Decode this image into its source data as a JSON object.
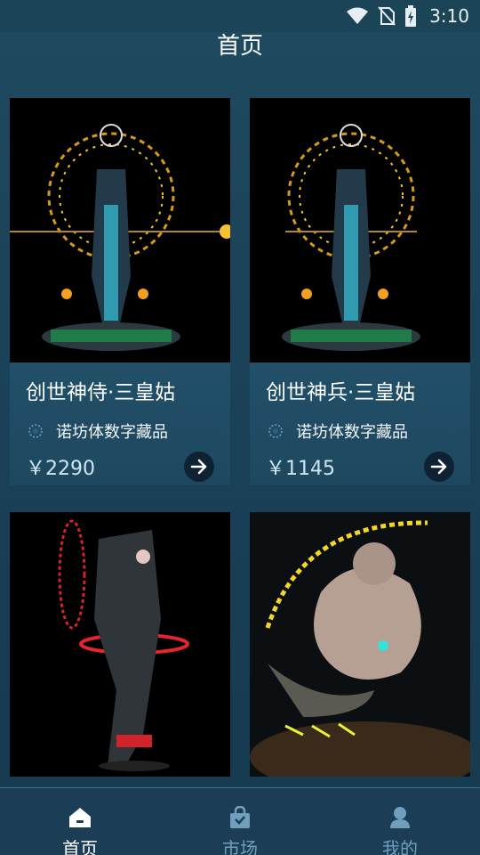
{
  "status_bar": {
    "time": "3:10",
    "icons": [
      "wifi-icon",
      "no-sim-icon",
      "battery-charging-icon"
    ]
  },
  "header": {
    "title": "首页"
  },
  "cards": [
    {
      "title": "创世神侍·三皇姑",
      "brand": "诺坊体数字藏品",
      "price": "￥2290",
      "image": "deity-statue-gold-halo"
    },
    {
      "title": "创世神兵·三皇姑",
      "brand": "诺坊体数字藏品",
      "price": "￥1145",
      "image": "deity-statue-gold-halo"
    },
    {
      "title": "",
      "brand": "",
      "price": "",
      "image": "mech-warrior-red-rings"
    },
    {
      "title": "",
      "brand": "",
      "price": "",
      "image": "ogre-golden-script-arc"
    }
  ],
  "tabs": [
    {
      "label": "首页",
      "icon": "home-icon",
      "active": true
    },
    {
      "label": "市场",
      "icon": "shopping-bag-icon",
      "active": false
    },
    {
      "label": "我的",
      "icon": "user-icon",
      "active": false
    }
  ],
  "colors": {
    "accent": "#ffffff",
    "inactive_tab": "#6f9fbd",
    "background": "#1a4258",
    "price": "#cfe6f5"
  }
}
